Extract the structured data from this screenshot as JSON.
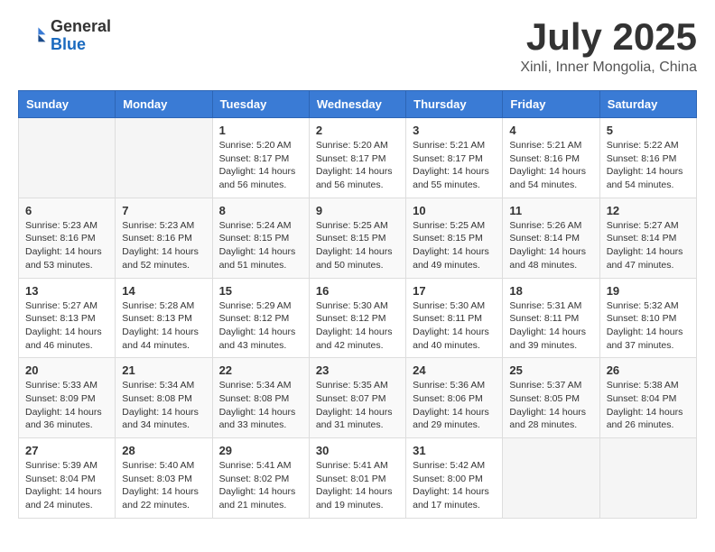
{
  "header": {
    "logo_general": "General",
    "logo_blue": "Blue",
    "month_title": "July 2025",
    "location": "Xinli, Inner Mongolia, China"
  },
  "calendar": {
    "days_of_week": [
      "Sunday",
      "Monday",
      "Tuesday",
      "Wednesday",
      "Thursday",
      "Friday",
      "Saturday"
    ],
    "weeks": [
      [
        {
          "day": "",
          "content": ""
        },
        {
          "day": "",
          "content": ""
        },
        {
          "day": "1",
          "content": "Sunrise: 5:20 AM\nSunset: 8:17 PM\nDaylight: 14 hours\nand 56 minutes."
        },
        {
          "day": "2",
          "content": "Sunrise: 5:20 AM\nSunset: 8:17 PM\nDaylight: 14 hours\nand 56 minutes."
        },
        {
          "day": "3",
          "content": "Sunrise: 5:21 AM\nSunset: 8:17 PM\nDaylight: 14 hours\nand 55 minutes."
        },
        {
          "day": "4",
          "content": "Sunrise: 5:21 AM\nSunset: 8:16 PM\nDaylight: 14 hours\nand 54 minutes."
        },
        {
          "day": "5",
          "content": "Sunrise: 5:22 AM\nSunset: 8:16 PM\nDaylight: 14 hours\nand 54 minutes."
        }
      ],
      [
        {
          "day": "6",
          "content": "Sunrise: 5:23 AM\nSunset: 8:16 PM\nDaylight: 14 hours\nand 53 minutes."
        },
        {
          "day": "7",
          "content": "Sunrise: 5:23 AM\nSunset: 8:16 PM\nDaylight: 14 hours\nand 52 minutes."
        },
        {
          "day": "8",
          "content": "Sunrise: 5:24 AM\nSunset: 8:15 PM\nDaylight: 14 hours\nand 51 minutes."
        },
        {
          "day": "9",
          "content": "Sunrise: 5:25 AM\nSunset: 8:15 PM\nDaylight: 14 hours\nand 50 minutes."
        },
        {
          "day": "10",
          "content": "Sunrise: 5:25 AM\nSunset: 8:15 PM\nDaylight: 14 hours\nand 49 minutes."
        },
        {
          "day": "11",
          "content": "Sunrise: 5:26 AM\nSunset: 8:14 PM\nDaylight: 14 hours\nand 48 minutes."
        },
        {
          "day": "12",
          "content": "Sunrise: 5:27 AM\nSunset: 8:14 PM\nDaylight: 14 hours\nand 47 minutes."
        }
      ],
      [
        {
          "day": "13",
          "content": "Sunrise: 5:27 AM\nSunset: 8:13 PM\nDaylight: 14 hours\nand 46 minutes."
        },
        {
          "day": "14",
          "content": "Sunrise: 5:28 AM\nSunset: 8:13 PM\nDaylight: 14 hours\nand 44 minutes."
        },
        {
          "day": "15",
          "content": "Sunrise: 5:29 AM\nSunset: 8:12 PM\nDaylight: 14 hours\nand 43 minutes."
        },
        {
          "day": "16",
          "content": "Sunrise: 5:30 AM\nSunset: 8:12 PM\nDaylight: 14 hours\nand 42 minutes."
        },
        {
          "day": "17",
          "content": "Sunrise: 5:30 AM\nSunset: 8:11 PM\nDaylight: 14 hours\nand 40 minutes."
        },
        {
          "day": "18",
          "content": "Sunrise: 5:31 AM\nSunset: 8:11 PM\nDaylight: 14 hours\nand 39 minutes."
        },
        {
          "day": "19",
          "content": "Sunrise: 5:32 AM\nSunset: 8:10 PM\nDaylight: 14 hours\nand 37 minutes."
        }
      ],
      [
        {
          "day": "20",
          "content": "Sunrise: 5:33 AM\nSunset: 8:09 PM\nDaylight: 14 hours\nand 36 minutes."
        },
        {
          "day": "21",
          "content": "Sunrise: 5:34 AM\nSunset: 8:08 PM\nDaylight: 14 hours\nand 34 minutes."
        },
        {
          "day": "22",
          "content": "Sunrise: 5:34 AM\nSunset: 8:08 PM\nDaylight: 14 hours\nand 33 minutes."
        },
        {
          "day": "23",
          "content": "Sunrise: 5:35 AM\nSunset: 8:07 PM\nDaylight: 14 hours\nand 31 minutes."
        },
        {
          "day": "24",
          "content": "Sunrise: 5:36 AM\nSunset: 8:06 PM\nDaylight: 14 hours\nand 29 minutes."
        },
        {
          "day": "25",
          "content": "Sunrise: 5:37 AM\nSunset: 8:05 PM\nDaylight: 14 hours\nand 28 minutes."
        },
        {
          "day": "26",
          "content": "Sunrise: 5:38 AM\nSunset: 8:04 PM\nDaylight: 14 hours\nand 26 minutes."
        }
      ],
      [
        {
          "day": "27",
          "content": "Sunrise: 5:39 AM\nSunset: 8:04 PM\nDaylight: 14 hours\nand 24 minutes."
        },
        {
          "day": "28",
          "content": "Sunrise: 5:40 AM\nSunset: 8:03 PM\nDaylight: 14 hours\nand 22 minutes."
        },
        {
          "day": "29",
          "content": "Sunrise: 5:41 AM\nSunset: 8:02 PM\nDaylight: 14 hours\nand 21 minutes."
        },
        {
          "day": "30",
          "content": "Sunrise: 5:41 AM\nSunset: 8:01 PM\nDaylight: 14 hours\nand 19 minutes."
        },
        {
          "day": "31",
          "content": "Sunrise: 5:42 AM\nSunset: 8:00 PM\nDaylight: 14 hours\nand 17 minutes."
        },
        {
          "day": "",
          "content": ""
        },
        {
          "day": "",
          "content": ""
        }
      ]
    ]
  }
}
